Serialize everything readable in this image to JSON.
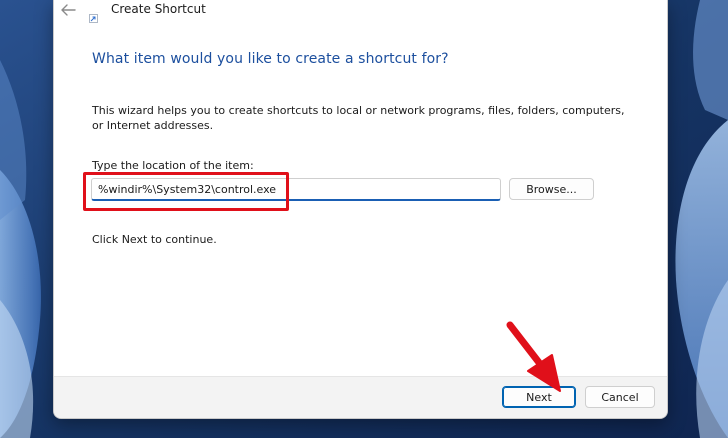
{
  "window": {
    "title": "Create Shortcut"
  },
  "wizard": {
    "heading": "What item would you like to create a shortcut for?",
    "description": "This wizard helps you to create shortcuts to local or network programs, files, folders, computers, or Internet addresses.",
    "field_label": "Type the location of the item:",
    "location_value": "%windir%\\System32\\control.exe",
    "browse_label": "Browse...",
    "continue_text": "Click Next to continue."
  },
  "footer": {
    "next_label": "Next",
    "cancel_label": "Cancel"
  },
  "colors": {
    "heading": "#1c4f9e",
    "accent": "#1a5fb4",
    "annotation_red": "#e0101a",
    "footer_bg": "#f3f3f3"
  },
  "icons": {
    "back": "back-arrow-icon",
    "app": "shortcut-app-icon",
    "annotation": "red-arrow-icon"
  }
}
